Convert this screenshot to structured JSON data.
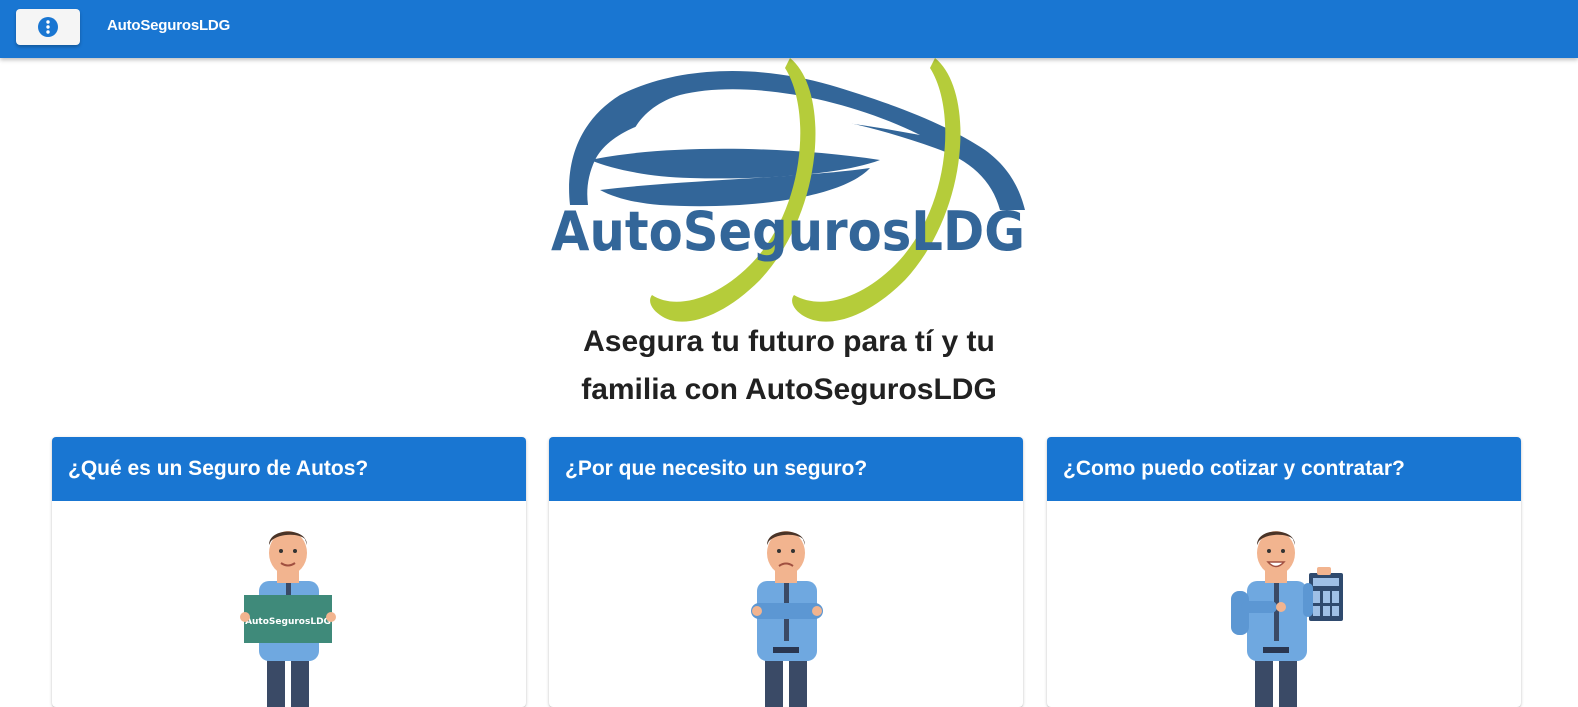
{
  "appbar": {
    "menu_icon": "more-vertical-icon",
    "title": "AutoSegurosLDG"
  },
  "logo": {
    "wordmark": "AutoSegurosLDG"
  },
  "hero": {
    "tagline_line1": "Asegura tu futuro para tí y tu",
    "tagline_line2": "familia con AutoSegurosLDG"
  },
  "cards": [
    {
      "title": "¿Qué es un Seguro de Autos?",
      "illustration": "man-holding-sign-illustration",
      "sign_text": "AutoSegurosLDG"
    },
    {
      "title": "¿Por que necesito un seguro?",
      "illustration": "man-arms-crossed-illustration"
    },
    {
      "title": "¿Como puedo cotizar y contratar?",
      "illustration": "man-with-calculator-illustration"
    }
  ],
  "colors": {
    "primary": "#1976d2",
    "logo_blue": "#336699",
    "logo_green": "#b5cc3a"
  }
}
